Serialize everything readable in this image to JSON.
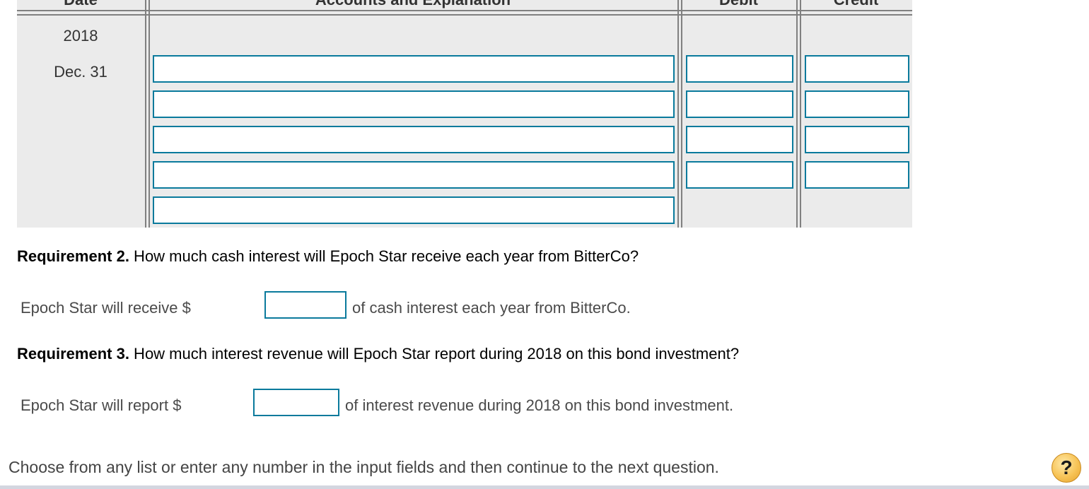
{
  "journal": {
    "headers": {
      "date": "Date",
      "accounts": "Accounts and Explanation",
      "debit": "Debit",
      "credit": "Credit"
    },
    "year": "2018",
    "date": "Dec. 31",
    "rows": [
      {
        "account": "",
        "debit": "",
        "credit": ""
      },
      {
        "account": "",
        "debit": "",
        "credit": ""
      },
      {
        "account": "",
        "debit": "",
        "credit": ""
      },
      {
        "account": "",
        "debit": "",
        "credit": ""
      },
      {
        "account": ""
      }
    ]
  },
  "requirement2": {
    "label": "Requirement 2.",
    "question": " How much cash interest will Epoch Star receive each year from BitterCo?",
    "prefix": "Epoch Star will receive $",
    "value": "",
    "suffix": "of cash interest each year from BitterCo."
  },
  "requirement3": {
    "label": "Requirement 3.",
    "question": " How much interest revenue will Epoch Star report during 2018 on this bond investment?",
    "prefix": "Epoch Star will report $",
    "value": "",
    "suffix": "of interest revenue during 2018 on this bond investment."
  },
  "footer": {
    "instruction": "Choose from any list or enter any number in the input fields and then continue to the next question.",
    "help_icon": "help-question-icon",
    "help_glyph": "?"
  },
  "colors": {
    "input_border": "#0a7a9c",
    "table_bg": "#ebebeb",
    "grid_line": "#808080"
  }
}
